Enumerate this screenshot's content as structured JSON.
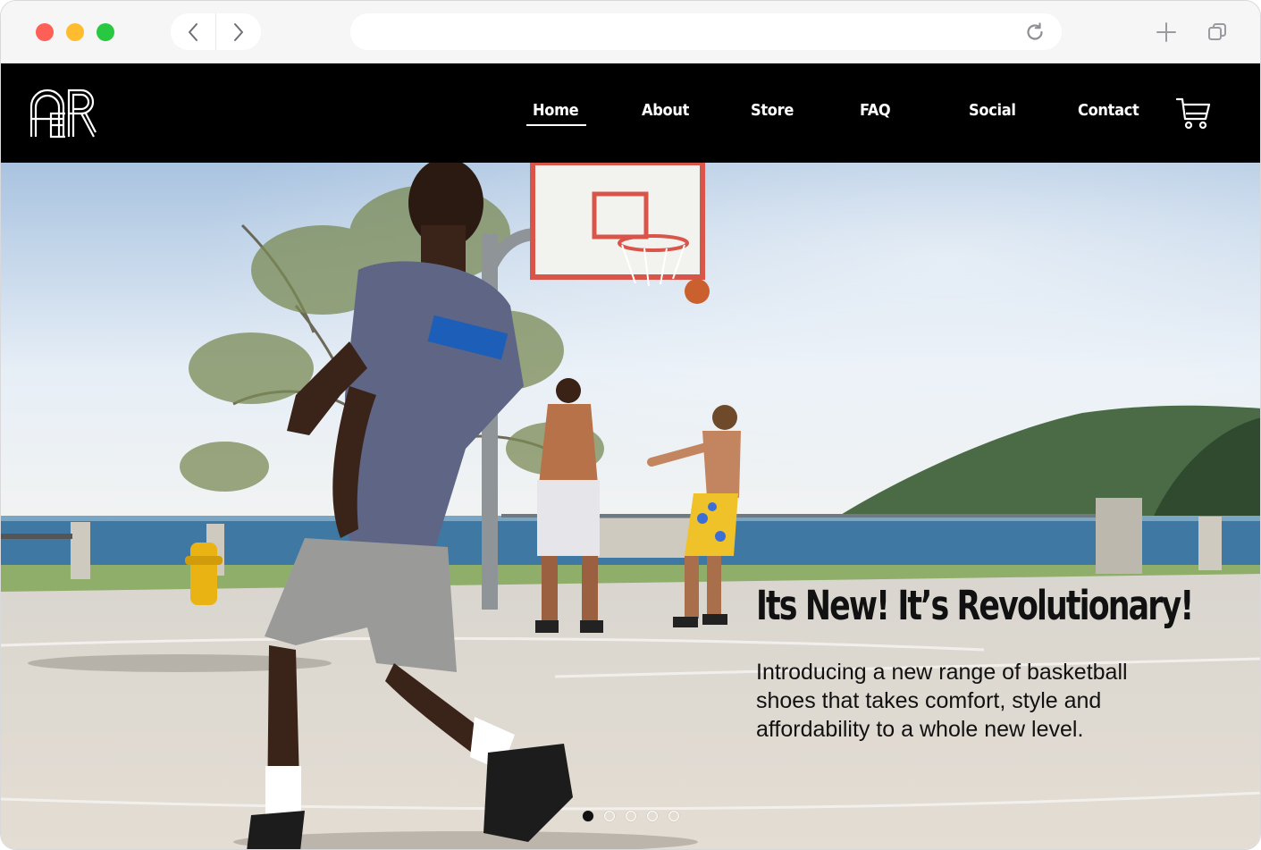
{
  "browser": {
    "url": "",
    "back_icon": "chevron-left-icon",
    "forward_icon": "chevron-right-icon",
    "reload_icon": "reload-icon",
    "new_tab_icon": "plus-icon",
    "tabs_icon": "tab-overview-icon",
    "traffic_lights": [
      "#fe5f57",
      "#febc2e",
      "#28c840"
    ]
  },
  "header": {
    "logo_icon": "aer-logo",
    "nav": [
      {
        "label": "Home",
        "active": true
      },
      {
        "label": "About",
        "active": false
      },
      {
        "label": "Store",
        "active": false
      },
      {
        "label": "FAQ",
        "active": false
      },
      {
        "label": "Social",
        "active": false
      },
      {
        "label": "Contact",
        "active": false
      }
    ],
    "cart_icon": "cart-icon",
    "background": "#000000"
  },
  "hero": {
    "image": "basketball-court-beach-photo",
    "headline": "Its New! It’s Revolutionary!",
    "subtext": "Introducing a new range of basketball shoes that takes comfort, style and affordability to a whole new level.",
    "carousel": {
      "slides": 5,
      "active_index": 0
    }
  }
}
